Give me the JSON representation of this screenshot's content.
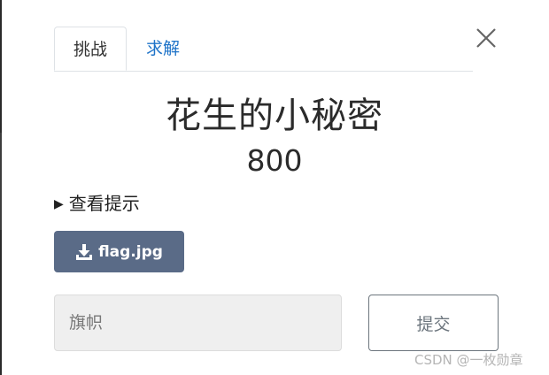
{
  "tabs": {
    "challenge": "挑战",
    "solves": "求解"
  },
  "challenge": {
    "name": "花生的小秘密",
    "value": "800",
    "hint_triangle": "▶",
    "hint_label": "查看提示",
    "file_label": "flag.jpg"
  },
  "form": {
    "flag_placeholder": "旗帜",
    "submit_label": "提交"
  },
  "watermark": "CSDN @一枚勋章",
  "colors": {
    "link_blue": "#1e73c8",
    "download_bg": "#5a6b87",
    "input_bg": "#efefef"
  }
}
